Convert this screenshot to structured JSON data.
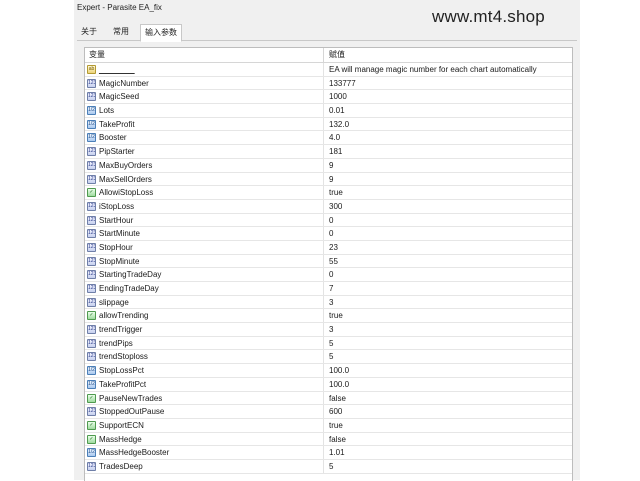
{
  "window": {
    "title": "Expert - Parasite EA_fix"
  },
  "watermark": "www.mt4.shop",
  "tabs": [
    {
      "label": "关于"
    },
    {
      "label": "常用"
    },
    {
      "label": "输入参数",
      "active": true
    }
  ],
  "table": {
    "headers": {
      "variable": "变量",
      "value": "赋值"
    },
    "rows": [
      {
        "type": "str",
        "icon": "ab",
        "name": "________",
        "value": "EA will manage magic number for each chart automatically"
      },
      {
        "type": "int",
        "icon": "123",
        "name": "MagicNumber",
        "value": "133777"
      },
      {
        "type": "int",
        "icon": "123",
        "name": "MagicSeed",
        "value": "1000"
      },
      {
        "type": "dbl",
        "icon": "1/2",
        "name": "Lots",
        "value": "0.01"
      },
      {
        "type": "dbl",
        "icon": "1/2",
        "name": "TakeProfit",
        "value": "132.0"
      },
      {
        "type": "dbl",
        "icon": "1/2",
        "name": "Booster",
        "value": "4.0"
      },
      {
        "type": "int",
        "icon": "123",
        "name": "PipStarter",
        "value": "181"
      },
      {
        "type": "int",
        "icon": "123",
        "name": "MaxBuyOrders",
        "value": "9"
      },
      {
        "type": "int",
        "icon": "123",
        "name": "MaxSellOrders",
        "value": "9"
      },
      {
        "type": "bool",
        "icon": "✓",
        "name": "AllowiStopLoss",
        "value": "true"
      },
      {
        "type": "int",
        "icon": "123",
        "name": "iStopLoss",
        "value": "300"
      },
      {
        "type": "int",
        "icon": "123",
        "name": "StartHour",
        "value": "0"
      },
      {
        "type": "int",
        "icon": "123",
        "name": "StartMinute",
        "value": "0"
      },
      {
        "type": "int",
        "icon": "123",
        "name": "StopHour",
        "value": "23"
      },
      {
        "type": "int",
        "icon": "123",
        "name": "StopMinute",
        "value": "55"
      },
      {
        "type": "int",
        "icon": "123",
        "name": "StartingTradeDay",
        "value": "0"
      },
      {
        "type": "int",
        "icon": "123",
        "name": "EndingTradeDay",
        "value": "7"
      },
      {
        "type": "int",
        "icon": "123",
        "name": "slippage",
        "value": "3"
      },
      {
        "type": "bool",
        "icon": "✓",
        "name": "allowTrending",
        "value": "true"
      },
      {
        "type": "int",
        "icon": "123",
        "name": "trendTrigger",
        "value": "3"
      },
      {
        "type": "int",
        "icon": "123",
        "name": "trendPips",
        "value": "5"
      },
      {
        "type": "int",
        "icon": "123",
        "name": "trendStoploss",
        "value": "5"
      },
      {
        "type": "dbl",
        "icon": "1/2",
        "name": "StopLossPct",
        "value": "100.0"
      },
      {
        "type": "dbl",
        "icon": "1/2",
        "name": "TakeProfitPct",
        "value": "100.0"
      },
      {
        "type": "bool",
        "icon": "✓",
        "name": "PauseNewTrades",
        "value": "false"
      },
      {
        "type": "int",
        "icon": "123",
        "name": "StoppedOutPause",
        "value": "600"
      },
      {
        "type": "bool",
        "icon": "✓",
        "name": "SupportECN",
        "value": "true"
      },
      {
        "type": "bool",
        "icon": "✓",
        "name": "MassHedge",
        "value": "false"
      },
      {
        "type": "dbl",
        "icon": "1/2",
        "name": "MassHedgeBooster",
        "value": "1.01"
      },
      {
        "type": "int",
        "icon": "123",
        "name": "TradesDeep",
        "value": "5"
      }
    ]
  }
}
